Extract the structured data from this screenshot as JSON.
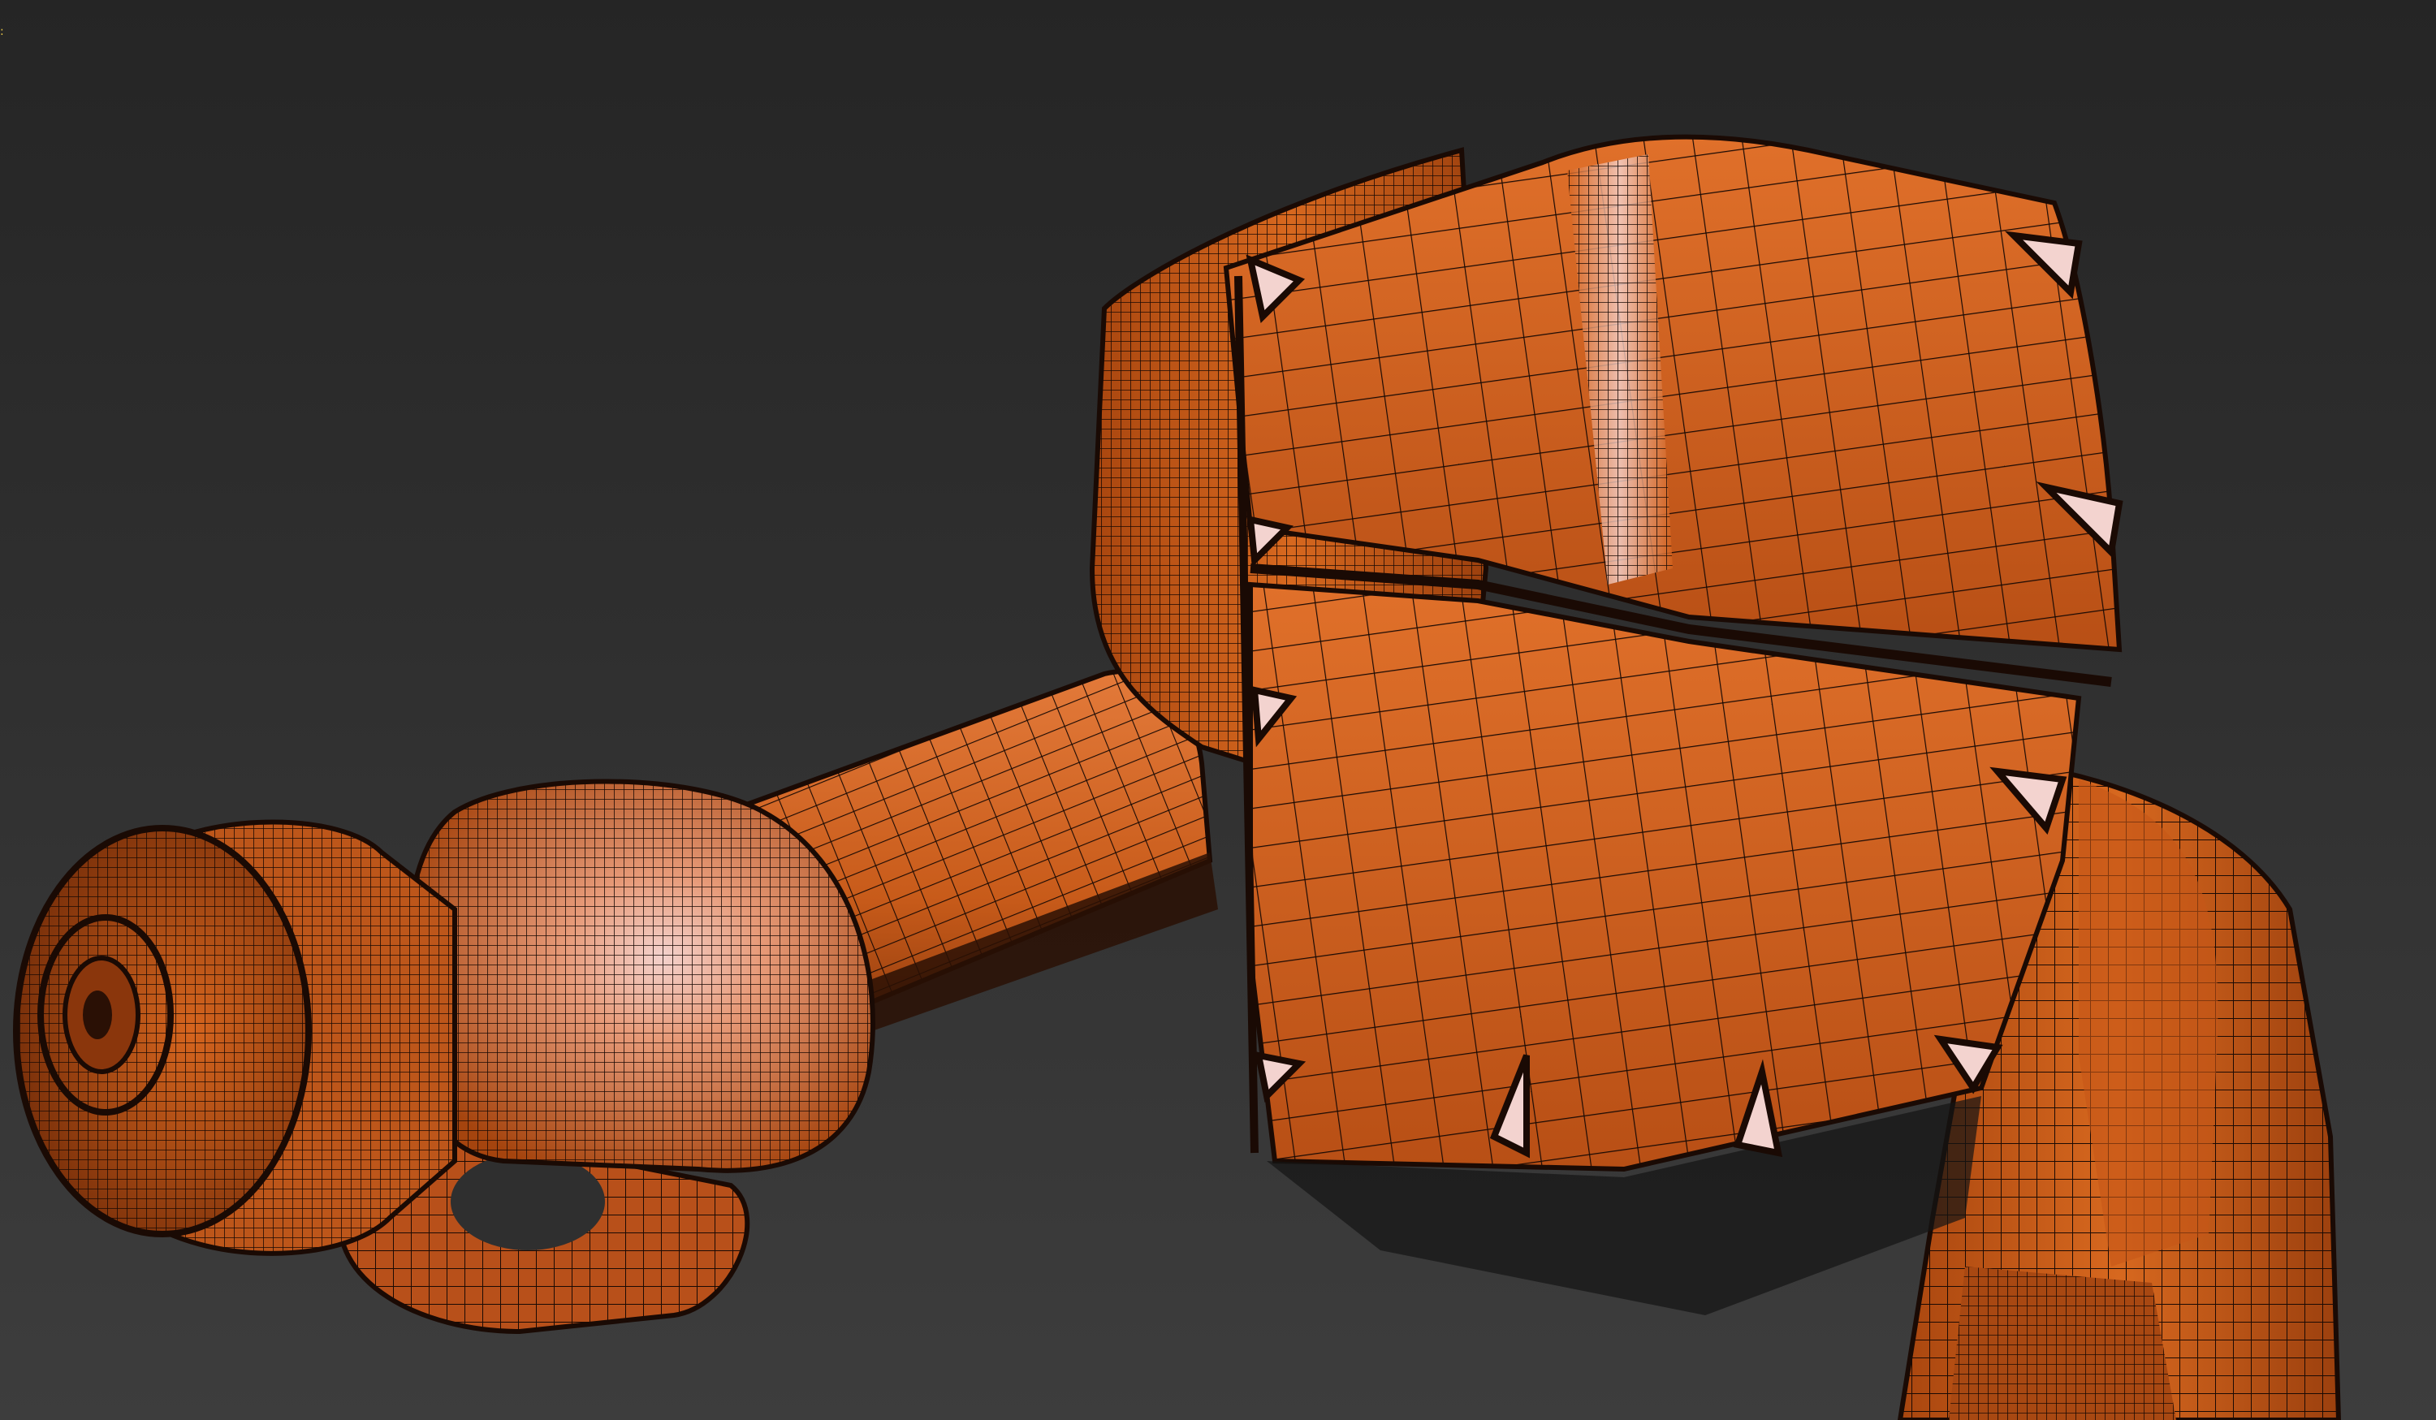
{
  "viewport": {
    "background_top": "#252525",
    "background_bottom": "#3d3d3d"
  },
  "model": {
    "subject": "industrial-robot-arm",
    "render_mode": "shaded-with-wireframe-edges",
    "surface_color": "#d4621c",
    "highlight_color": "#f3c4bc",
    "shadow_color": "#3a1707",
    "wire_color": "#1a0a04"
  },
  "corner_mark": {
    "color": "#e8c84a",
    "label": ":"
  }
}
